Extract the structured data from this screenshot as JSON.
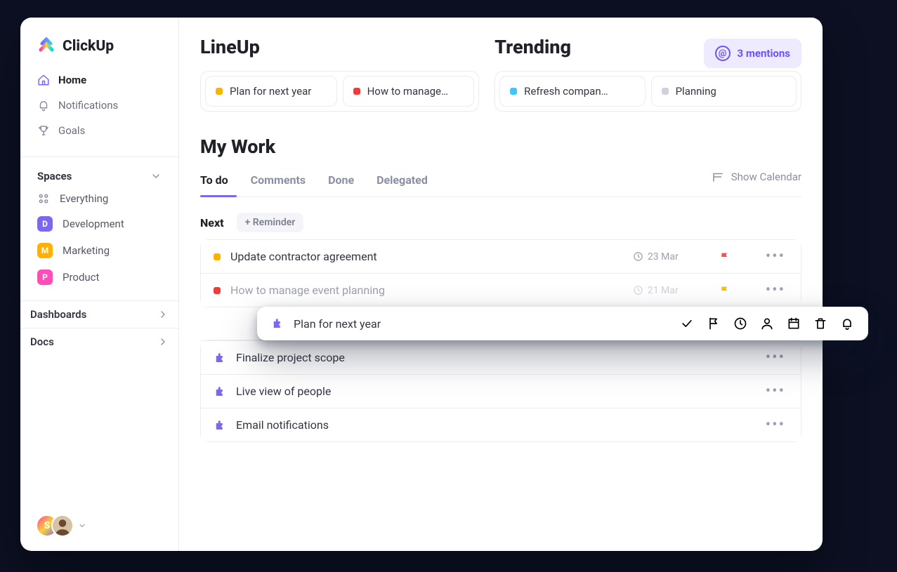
{
  "brand": "ClickUp",
  "nav": {
    "items": [
      {
        "label": "Home",
        "active": true,
        "icon": "home-icon"
      },
      {
        "label": "Notifications",
        "active": false,
        "icon": "bell-icon"
      },
      {
        "label": "Goals",
        "active": false,
        "icon": "trophy-icon"
      }
    ],
    "spaces_header": "Spaces",
    "spaces": [
      {
        "label": "Everything",
        "type": "everything"
      },
      {
        "label": "Development",
        "badge": "D",
        "color": "#7b68ee"
      },
      {
        "label": "Marketing",
        "badge": "M",
        "color": "#ffb100"
      },
      {
        "label": "Product",
        "badge": "P",
        "color": "#ff4db8"
      }
    ],
    "footer_items": [
      {
        "label": "Dashboards"
      },
      {
        "label": "Docs"
      }
    ]
  },
  "mentions": {
    "label": "3 mentions"
  },
  "lineup": {
    "title": "LineUp",
    "cards": [
      {
        "label": "Plan for next year",
        "color": "#ffb100"
      },
      {
        "label": "How to manage…",
        "color": "#ef3b3b"
      }
    ]
  },
  "trending": {
    "title": "Trending",
    "cards": [
      {
        "label": "Refresh compan…",
        "color": "#3cc7ff"
      },
      {
        "label": "Planning",
        "color": "#cfd1dc"
      }
    ]
  },
  "mywork": {
    "title": "My Work",
    "tabs": [
      {
        "label": "To do",
        "active": true
      },
      {
        "label": "Comments"
      },
      {
        "label": "Done"
      },
      {
        "label": "Delegated"
      }
    ],
    "show_calendar": "Show Calendar",
    "next_label": "Next",
    "reminder_label": "+ Reminder",
    "next_tasks": [
      {
        "title": "Update contractor agreement",
        "color": "#ffb100",
        "date": "23 Mar",
        "flag": "#ff4b4b"
      },
      {
        "title": "How to manage event planning",
        "color": "#ef3b3b",
        "date": "21 Mar",
        "flag": "#ffbb00",
        "cut": true
      }
    ],
    "plain_tasks": [
      {
        "title": "Finalize project scope"
      },
      {
        "title": "Live view of people"
      },
      {
        "title": "Email notifications"
      }
    ]
  },
  "popover": {
    "title": "Plan for next year"
  },
  "users": [
    {
      "initial": "S"
    },
    {
      "type": "photo"
    }
  ]
}
